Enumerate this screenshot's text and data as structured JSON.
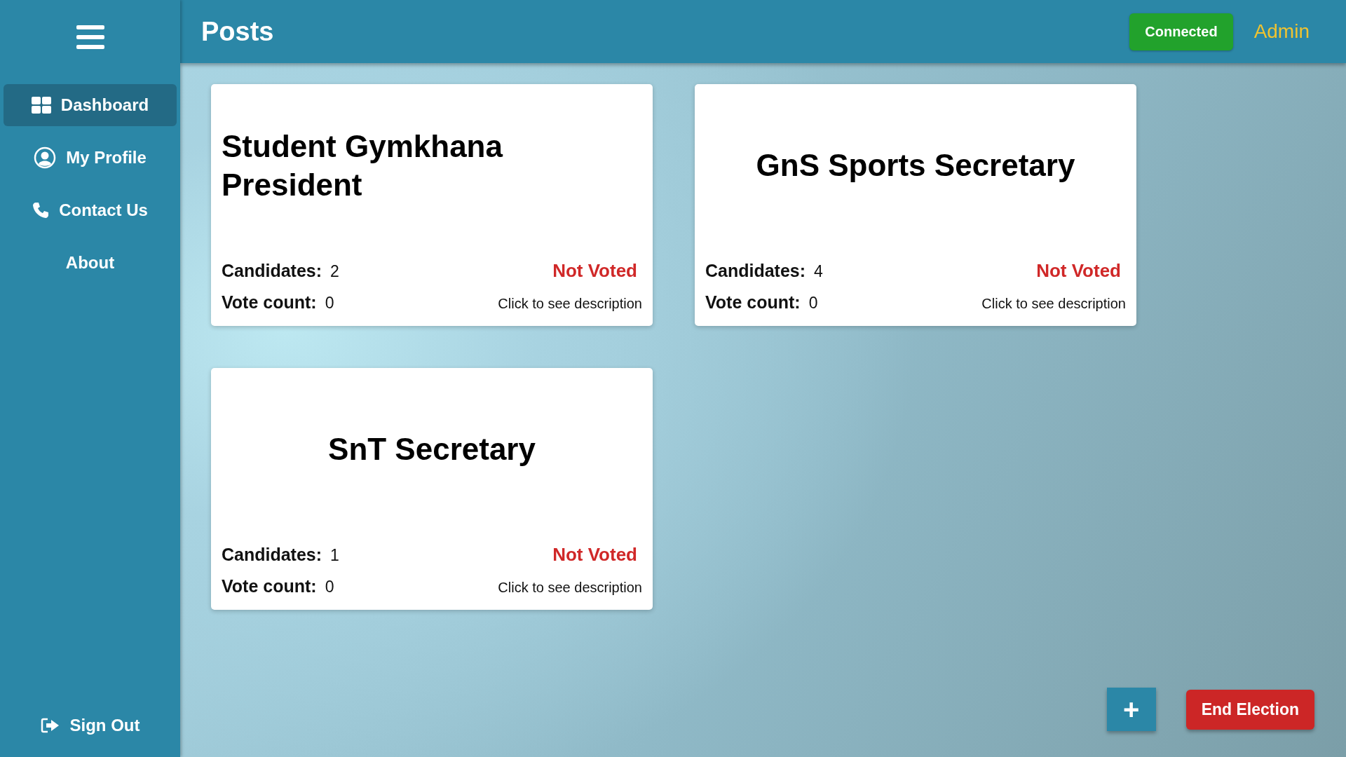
{
  "sidebar": {
    "items": [
      {
        "label": "Dashboard",
        "kind": "grid",
        "selected": true
      },
      {
        "label": "My Profile",
        "kind": "user",
        "selected": false
      },
      {
        "label": "Contact Us",
        "kind": "phone",
        "selected": false
      },
      {
        "label": "About",
        "kind": "text",
        "selected": false
      }
    ],
    "sign_out": "Sign Out"
  },
  "header": {
    "title": "Posts",
    "status": "Connected",
    "user": "Admin"
  },
  "cards": [
    {
      "title": "Student Gymkhana President",
      "candidates_label": "Candidates:",
      "candidates": "2",
      "votes_label": "Vote count:",
      "votes": "0",
      "voted": false,
      "status": "Not Voted",
      "link": "Click to see description"
    },
    {
      "title": "GnS Sports Secretary",
      "candidates_label": "Candidates:",
      "candidates": "4",
      "votes_label": "Vote count:",
      "votes": "0",
      "voted": false,
      "status": "Not Voted",
      "link": "Click to see description"
    },
    {
      "title": "SnT Secretary",
      "candidates_label": "Candidates:",
      "candidates": "1",
      "votes_label": "Vote count:",
      "votes": "0",
      "voted": false,
      "status": "Not Voted",
      "link": "Click to see description"
    }
  ],
  "actions": {
    "add": "+",
    "end": "End Election"
  }
}
